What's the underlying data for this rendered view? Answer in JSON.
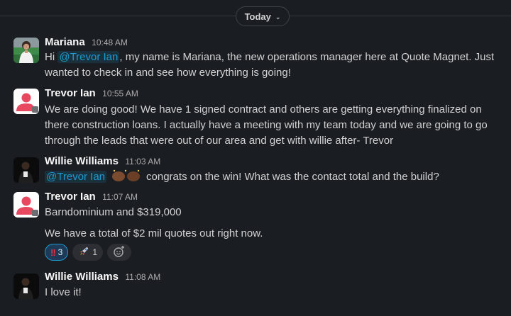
{
  "date_divider": {
    "label": "Today"
  },
  "messages": [
    {
      "sender": "Mariana",
      "time": "10:48 AM",
      "pre": "Hi ",
      "mention": "@Trevor Ian",
      "post": ", my name is Mariana, the new operations manager here at Quote Magnet. Just wanted to check in and see how everything is going!"
    },
    {
      "sender": "Trevor Ian",
      "time": "10:55 AM",
      "text": "We are doing good! We have 1 signed contract and others are getting everything finalized on there construction loans. I actually have a meeting with my team today and we are going to go through the leads that were out of our area and get with willie after- Trevor"
    },
    {
      "sender": "Willie Williams",
      "time": "11:03 AM",
      "mention": "@Trevor Ian",
      "post": "congrats on the win! What was the contact total and the build?"
    },
    {
      "sender": "Trevor Ian",
      "time": "11:07 AM",
      "line1": "Barndominium and $319,000",
      "line2": "We have a total of $2 mil quotes out right now.",
      "reactions": [
        {
          "icon": "double-exclamation",
          "count": "3"
        },
        {
          "icon": "rocket",
          "count": "1"
        }
      ]
    },
    {
      "sender": "Willie Williams",
      "time": "11:08 AM",
      "text": "I love it!"
    }
  ],
  "colors": {
    "background": "#1a1d21",
    "mention": "#1d9bd1",
    "trevor_avatar": "#e8485f"
  }
}
